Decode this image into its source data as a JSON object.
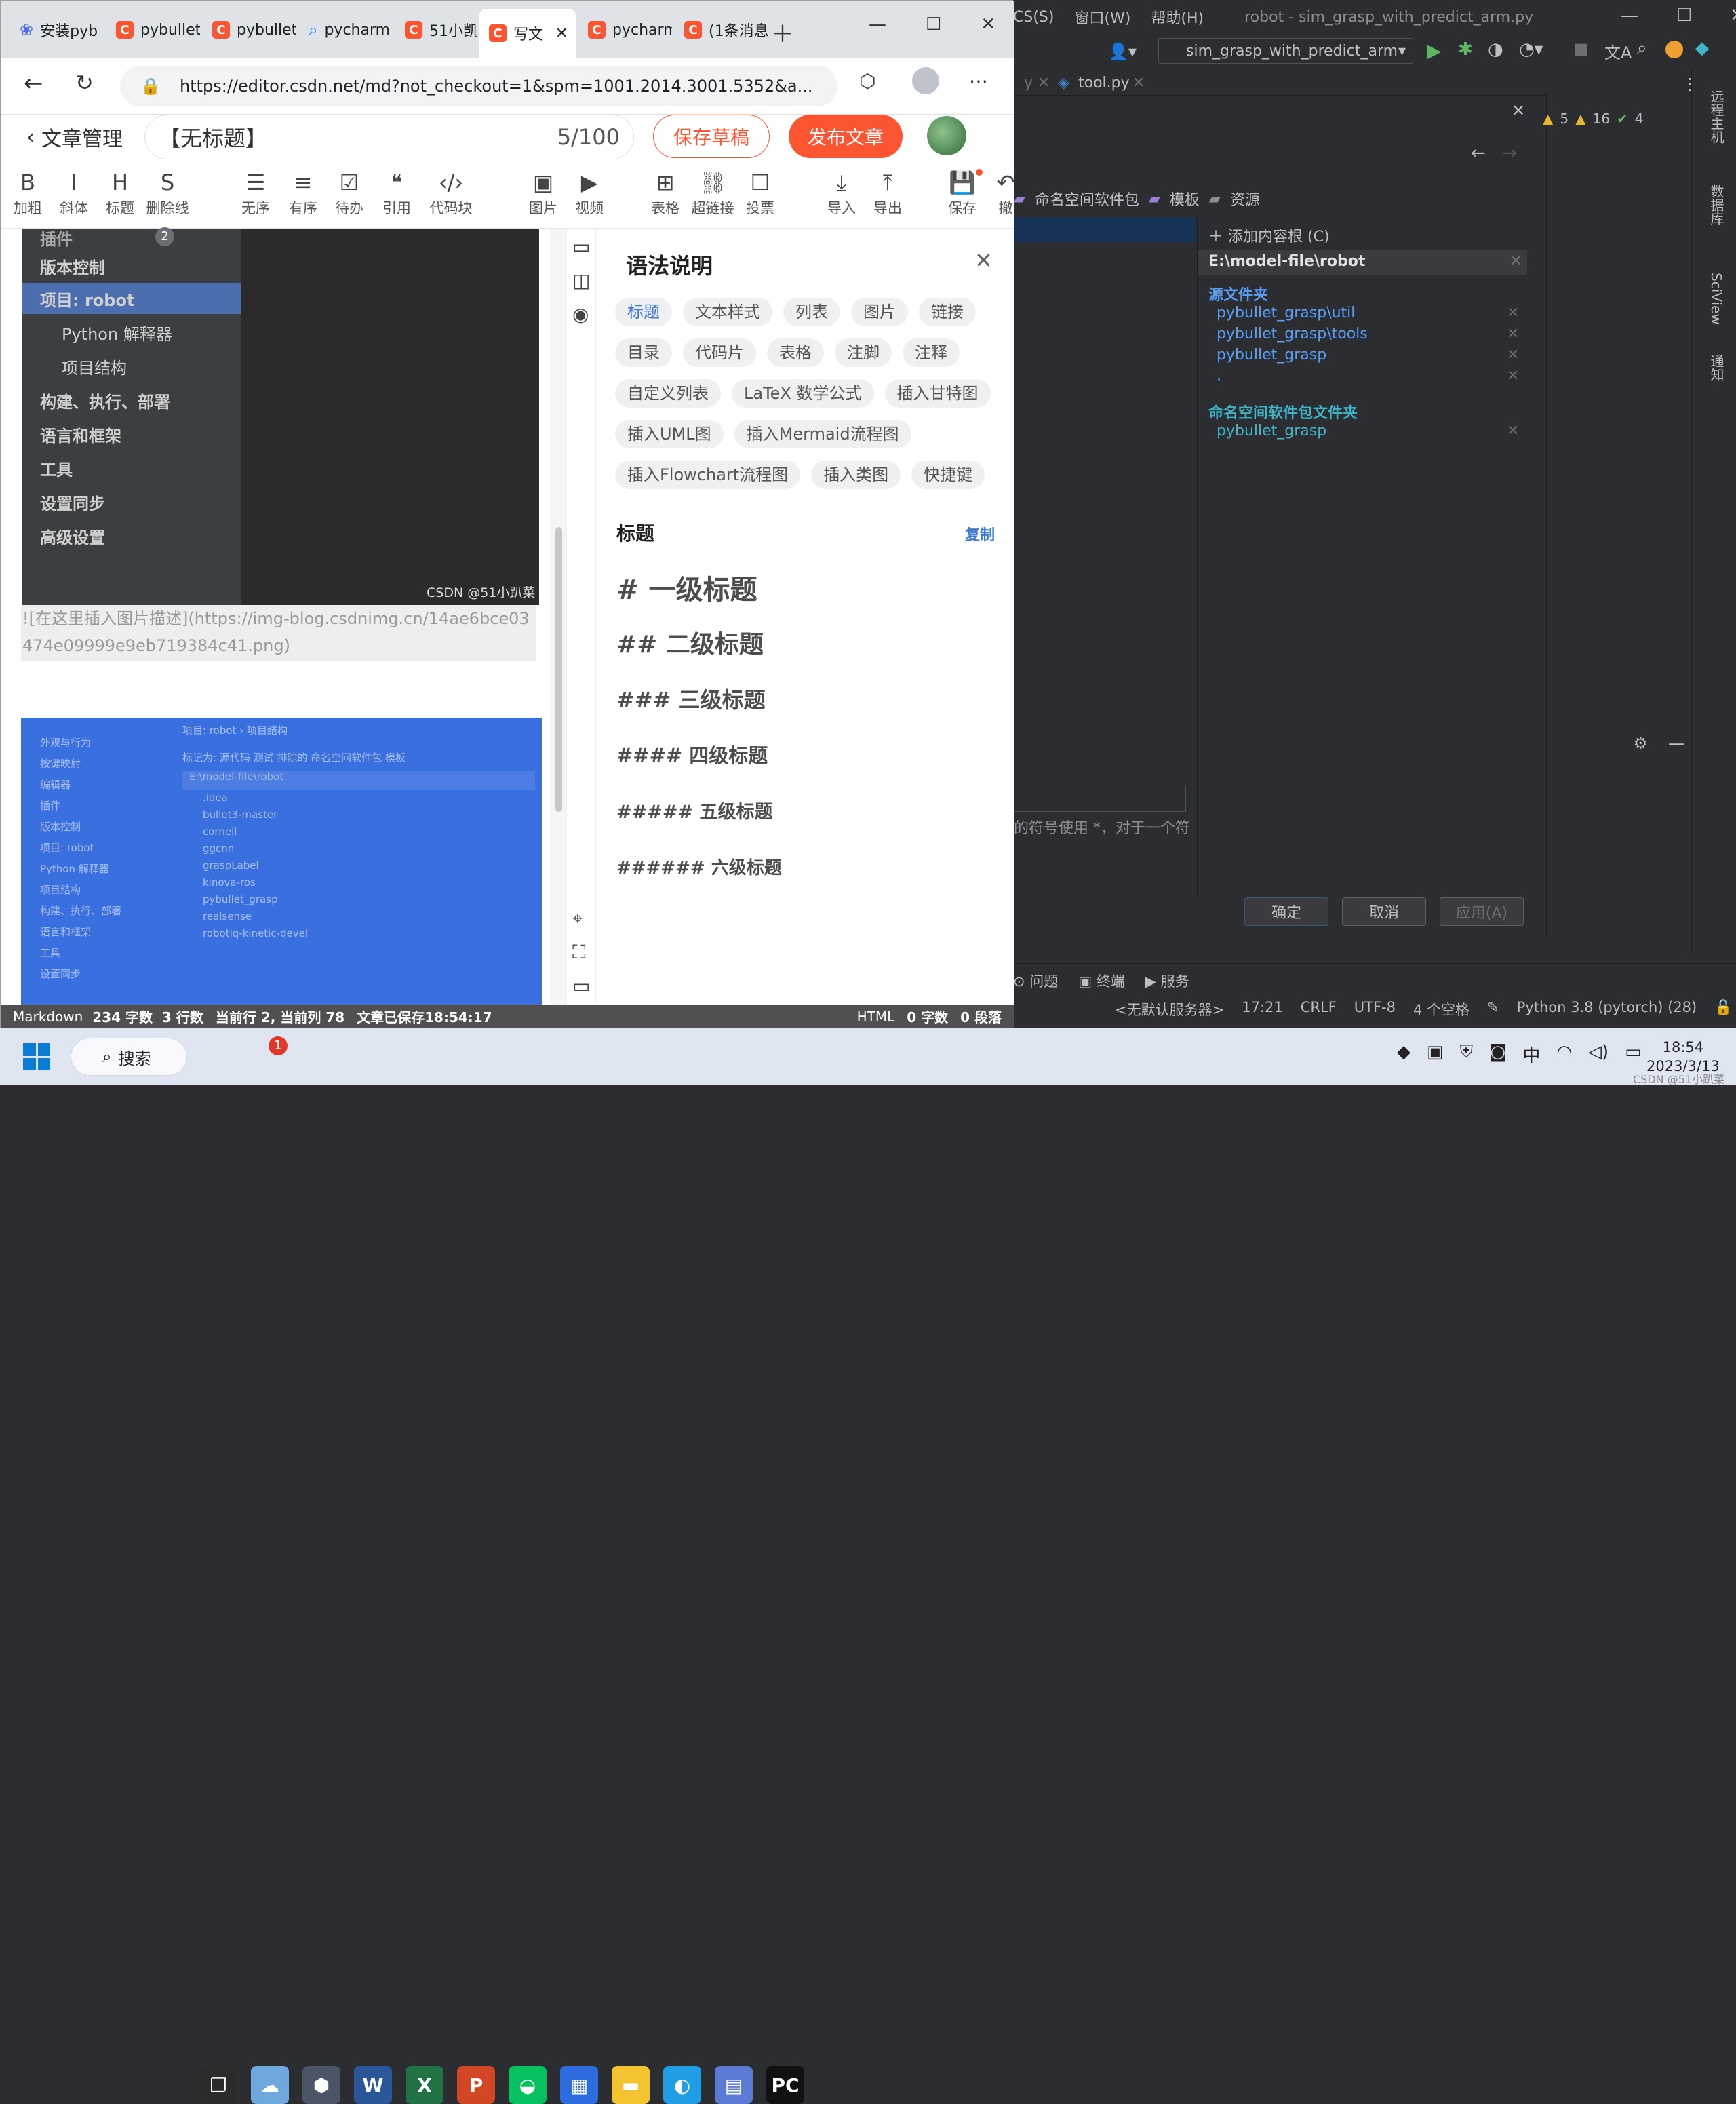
{
  "ide": {
    "menu": [
      "CS(S)",
      "窗口(W)",
      "帮助(H)",
      "robot - sim_grasp_with_predict_arm.py"
    ],
    "run_config": "sim_grasp_with_predict_arm",
    "tab_file": "tool.py",
    "inspections": {
      "warn": "5",
      "weak": "16",
      "ok": "4"
    },
    "toolbar_links": [
      "命名空间软件包",
      "模板",
      "资源"
    ],
    "add_root": "添加内容根 (C)",
    "root_path": "E:\\model-file\\robot",
    "source_title": "源文件夹",
    "sources": [
      "pybullet_grasp\\util",
      "pybullet_grasp\\tools",
      "pybullet_grasp",
      "."
    ],
    "ns_title": "命名空间软件包文件夹",
    "ns_items": [
      "pybullet_grasp"
    ],
    "hint": "的符号使用 *，对于一个符",
    "ok": "确定",
    "cancel": "取消",
    "apply": "应用(A)",
    "bottom_tabs": [
      "问题",
      "终端",
      "服务"
    ],
    "status": [
      "<无默认服务器>",
      "17:21",
      "CRLF",
      "UTF-8",
      "4 个空格",
      "Python 3.8 (pytorch) (28)"
    ],
    "right_strip": [
      "远程主机",
      "数据库",
      "SciView",
      "通知"
    ]
  },
  "browser": {
    "tabs": [
      "安装pyb",
      "pybullet",
      "pybullet",
      "pycharm",
      "51小凯",
      "写文",
      "pycharm",
      "(1条消息"
    ],
    "url": "https://editor.csdn.net/md?not_checkout=1&spm=1001.2014.3001.5352&a...",
    "back_label": "文章管理",
    "title": "【无标题】",
    "title_count": "5/100",
    "save_draft": "保存草稿",
    "publish": "发布文章"
  },
  "toolbar": [
    {
      "icon": "B",
      "label": "加粗"
    },
    {
      "icon": "I",
      "label": "斜体"
    },
    {
      "icon": "H",
      "label": "标题"
    },
    {
      "icon": "S",
      "label": "删除线"
    },
    {
      "icon": "☰",
      "label": "无序"
    },
    {
      "icon": "≡",
      "label": "有序"
    },
    {
      "icon": "☑",
      "label": "待办"
    },
    {
      "icon": "❝",
      "label": "引用"
    },
    {
      "icon": "‹/›",
      "label": "代码块"
    },
    {
      "icon": "▣",
      "label": "图片"
    },
    {
      "icon": "▶",
      "label": "视频"
    },
    {
      "icon": "⊞",
      "label": "表格"
    },
    {
      "icon": "⛓",
      "label": "超链接"
    },
    {
      "icon": "☐",
      "label": "投票"
    },
    {
      "icon": "⤓",
      "label": "导入"
    },
    {
      "icon": "⤒",
      "label": "导出"
    },
    {
      "icon": "💾",
      "label": "保存"
    },
    {
      "icon": "↶",
      "label": "撤"
    }
  ],
  "shot": {
    "items": [
      "插件",
      "版本控制",
      "项目: robot",
      "Python 解释器",
      "项目结构",
      "构建、执行、部署",
      "语言和框架",
      "工具",
      "设置同步",
      "高级设置"
    ],
    "badge": "2",
    "watermark": "CSDN @51小趴菜"
  },
  "image_markdown": "![在这里插入图片描述](https://img-blog.csdnimg.cn/14ae6bce03474e09999e9eb719384c41.png)",
  "shot2": {
    "breadcrumb": "项目: robot  ›  项目结构",
    "marks": "标记为:   源代码   测试   排除的   命名空间软件包   模板",
    "root": "E:\\model-file\\robot",
    "folders": [
      ".idea",
      "bullet3-master",
      "cornell",
      "ggcnn",
      "graspLabel",
      "kinova-ros",
      "pybullet_grasp",
      "realsense",
      "robotiq-kinetic-devel"
    ],
    "left": [
      "外观与行为",
      "按键映射",
      "编辑器",
      "插件",
      "版本控制",
      "项目: robot",
      "Python 解释器",
      "项目结构",
      "构建、执行、部署",
      "语言和框架",
      "工具",
      "设置同步"
    ]
  },
  "help": {
    "title": "语法说明",
    "tags": [
      "标题",
      "文本样式",
      "列表",
      "图片",
      "链接",
      "目录",
      "代码片",
      "表格",
      "注脚",
      "注释",
      "自定义列表",
      "LaTeX 数学公式",
      "插入甘特图",
      "插入UML图",
      "插入Mermaid流程图",
      "插入Flowchart流程图",
      "插入类图",
      "快捷键"
    ],
    "section": "标题",
    "copy": "复制",
    "headings": [
      "# 一级标题",
      "## 二级标题",
      "### 三级标题",
      "#### 四级标题",
      "##### 五级标题",
      "###### 六级标题"
    ]
  },
  "bstatus": {
    "mode": "Markdown",
    "chars": "234 字数",
    "lines": "3 行数",
    "pos": "当前行 2, 当前列 78",
    "saved": "文章已保存18:54:17",
    "html": "HTML",
    "html_chars": "0 字数",
    "paras": "0 段落"
  },
  "taskbar": {
    "search": "搜索",
    "badge": "1",
    "ime": "中",
    "time": "18:54",
    "date": "2023/3/13",
    "watermark": "CSDN @51小趴菜"
  },
  "colors": {
    "csdn": "#fc5531",
    "ide_bg": "#2b2d30",
    "link": "#589df6"
  }
}
